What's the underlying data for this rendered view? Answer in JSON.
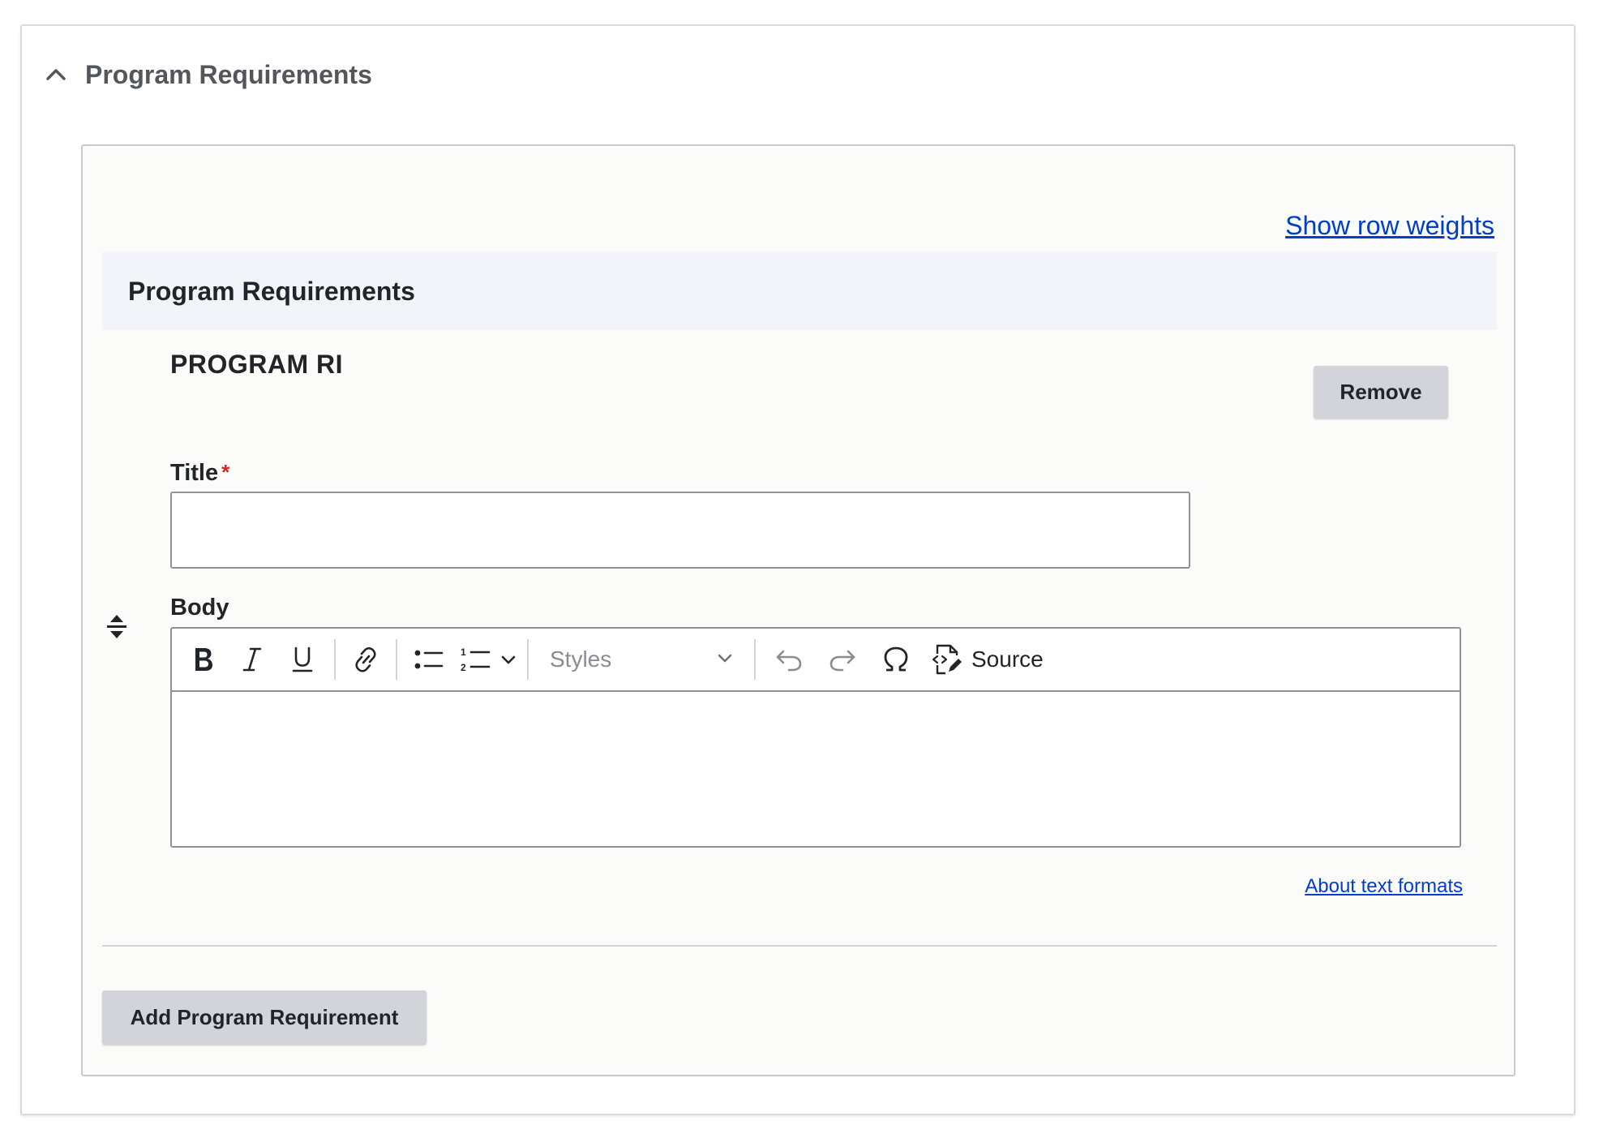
{
  "details": {
    "summary_label": "Program Requirements"
  },
  "table": {
    "show_row_weights": "Show row weights",
    "header_label": "Program Requirements"
  },
  "paragraph": {
    "type_label": "PROGRAM RI",
    "remove_label": "Remove",
    "title_label": "Title",
    "title_required_mark": "*",
    "title_value": "",
    "body_label": "Body",
    "styles_placeholder": "Styles",
    "source_label": "Source",
    "about_formats": "About text formats"
  },
  "actions": {
    "add_label": "Add Program Requirement"
  },
  "toolbar": {
    "icons": [
      "bold-icon",
      "italic-icon",
      "underline-icon",
      "link-icon",
      "bulleted-list-icon",
      "numbered-list-icon",
      "chevron-down-icon",
      "undo-icon",
      "redo-icon",
      "special-characters-icon",
      "source-icon"
    ]
  },
  "colors": {
    "link": "#003ecc",
    "required": "#d72222",
    "button_bg": "#d3d4d9",
    "header_bg": "#f3f4f9"
  }
}
